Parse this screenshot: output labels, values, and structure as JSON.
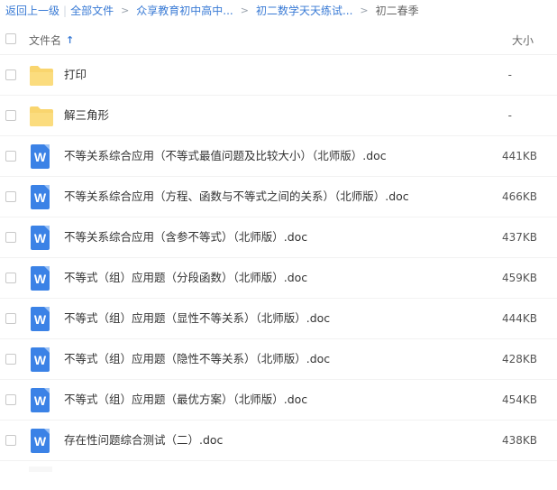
{
  "breadcrumb": {
    "back": "返回上一级",
    "all_files": "全部文件",
    "crumbs": [
      "众享教育初中高中...",
      "初二数学天天练试...",
      "初二春季"
    ]
  },
  "header": {
    "name_label": "文件名",
    "size_label": "大小",
    "sort_icon": "arrow-up-icon"
  },
  "colors": {
    "link": "#3a7bd5",
    "word_icon": "#3b82e6",
    "folder": "#f9d56e"
  },
  "files": [
    {
      "type": "folder",
      "icon": "folder-icon",
      "name": "打印",
      "size": "-"
    },
    {
      "type": "folder",
      "icon": "folder-icon",
      "name": "解三角形",
      "size": "-"
    },
    {
      "type": "doc",
      "icon": "word-doc-icon",
      "glyph": "W",
      "name": "不等关系综合应用（不等式最值问题及比较大小）（北师版）.doc",
      "size": "441KB"
    },
    {
      "type": "doc",
      "icon": "word-doc-icon",
      "glyph": "W",
      "name": "不等关系综合应用（方程、函数与不等式之间的关系）（北师版）.doc",
      "size": "466KB"
    },
    {
      "type": "doc",
      "icon": "word-doc-icon",
      "glyph": "W",
      "name": "不等关系综合应用（含参不等式）（北师版）.doc",
      "size": "437KB"
    },
    {
      "type": "doc",
      "icon": "word-doc-icon",
      "glyph": "W",
      "name": "不等式（组）应用题（分段函数）（北师版）.doc",
      "size": "459KB"
    },
    {
      "type": "doc",
      "icon": "word-doc-icon",
      "glyph": "W",
      "name": "不等式（组）应用题（显性不等关系）（北师版）.doc",
      "size": "444KB"
    },
    {
      "type": "doc",
      "icon": "word-doc-icon",
      "glyph": "W",
      "name": "不等式（组）应用题（隐性不等关系）（北师版）.doc",
      "size": "428KB"
    },
    {
      "type": "doc",
      "icon": "word-doc-icon",
      "glyph": "W",
      "name": "不等式（组）应用题（最优方案）（北师版）.doc",
      "size": "454KB"
    },
    {
      "type": "doc",
      "icon": "word-doc-icon",
      "glyph": "W",
      "name": "存在性问题综合测试（二）.doc",
      "size": "438KB"
    }
  ]
}
